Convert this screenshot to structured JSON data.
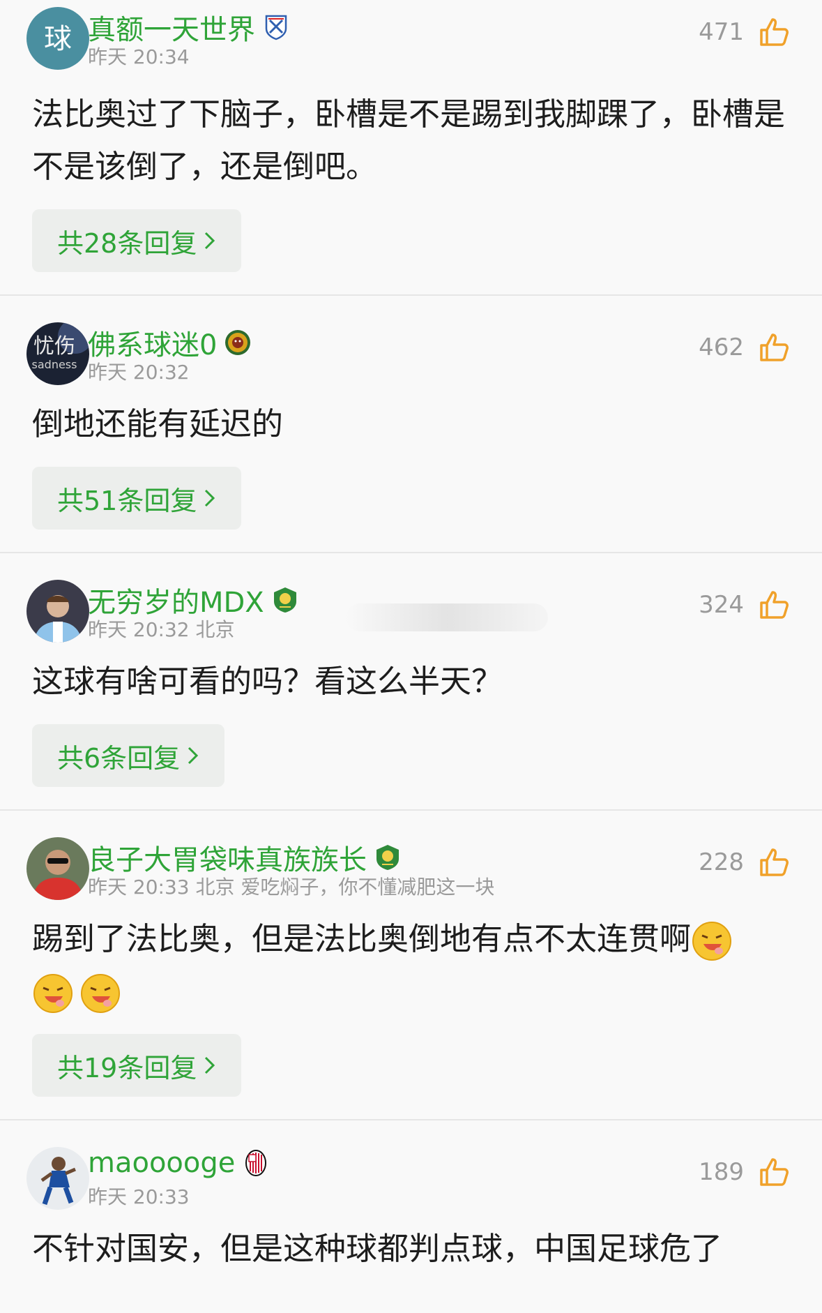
{
  "comments": [
    {
      "avatar_label": "球",
      "username": "真额一天世界",
      "badge_icon": "shenhua-club-badge",
      "time": "昨天 20:34",
      "likes": "471",
      "text": "法比奥过了下脑子，卧槽是不是踢到我脚踝了，卧槽是不是该倒了，还是倒吧。",
      "replies": "共28条回复"
    },
    {
      "avatar_label": "忧伤",
      "avatar_sub": "sadness",
      "username": "佛系球迷0",
      "badge_icon": "lion-club-badge",
      "time": "昨天 20:32",
      "likes": "462",
      "text": "倒地还能有延迟的",
      "replies": "共51条回复"
    },
    {
      "username": "无穷岁的MDX",
      "badge_icon": "guoan-club-badge",
      "time": "昨天 20:32 北京",
      "likes": "324",
      "text": "这球有啥可看的吗？看这么半天？",
      "replies": "共6条回复"
    },
    {
      "username": "良子大胃袋味真族族长",
      "badge_icon": "guoan-club-badge",
      "time": "昨天 20:33 北京 爱吃焖子，你不懂减肥这一块",
      "likes": "228",
      "text": "踢到了法比奥，但是法比奥倒地有点不太连贯啊",
      "emoji_icon": "drooling-face-emoji",
      "replies": "共19条回复"
    },
    {
      "username": "maooooge",
      "badge_icon": "ac-milan-badge",
      "time": "昨天 20:33",
      "likes": "189",
      "text": "不针对国安，但是这种球都判点球，中国足球危了"
    }
  ],
  "colors": {
    "accent": "#2fa438",
    "like": "#f0a12a",
    "meta": "#9a9a9a"
  }
}
